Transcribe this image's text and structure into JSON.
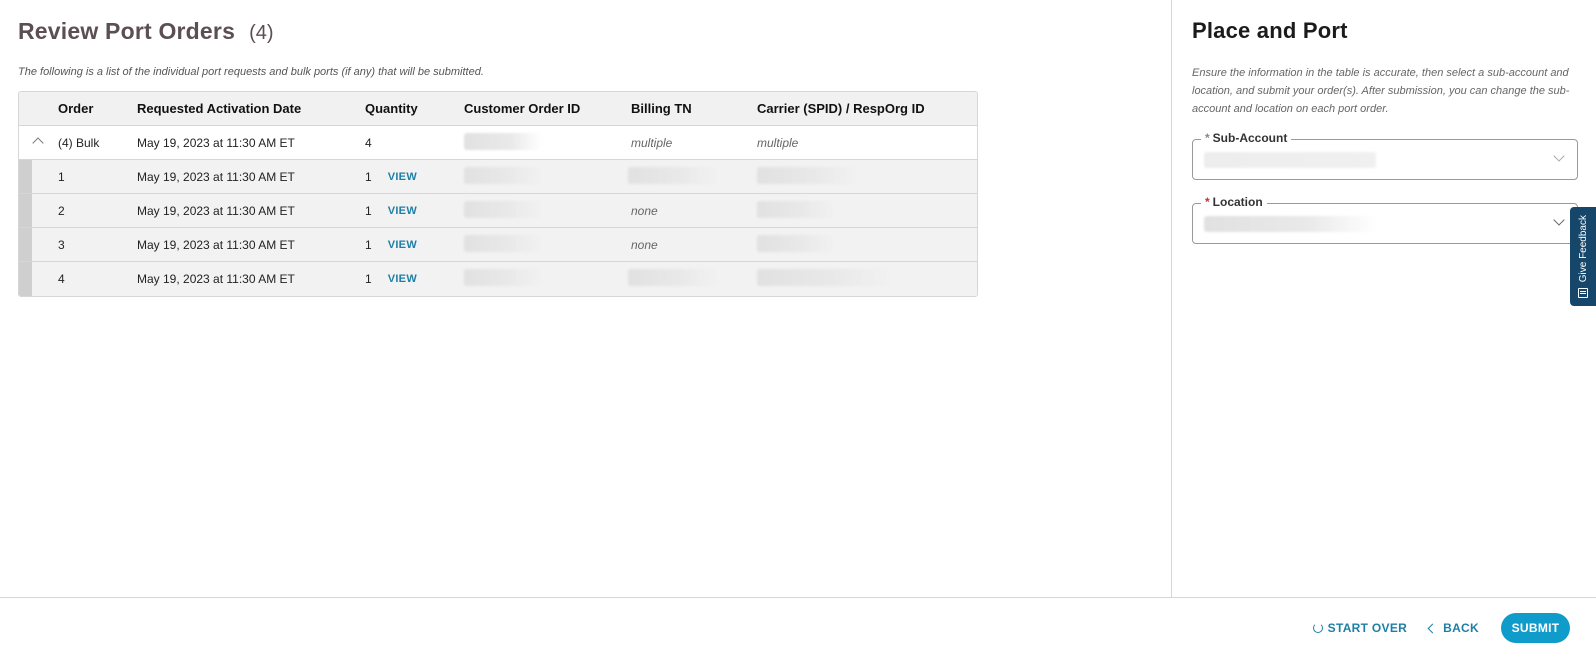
{
  "main": {
    "title": "Review Port Orders",
    "count": "(4)",
    "subtitle": "The following is a list of the individual port requests and bulk ports (if any) that will be submitted."
  },
  "table": {
    "headers": [
      "Order",
      "Requested Activation Date",
      "Quantity",
      "Customer Order ID",
      "Billing TN",
      "Carrier (SPID) / RespOrg ID"
    ],
    "bulk_row": {
      "order": "(4) Bulk",
      "date": "May 19, 2023 at 11:30 AM ET",
      "quantity": "4",
      "billing_tn": "multiple",
      "carrier": "multiple"
    },
    "rows": [
      {
        "order": "1",
        "date": "May 19, 2023 at 11:30 AM ET",
        "quantity": "1",
        "action": "VIEW",
        "billing_tn": ""
      },
      {
        "order": "2",
        "date": "May 19, 2023 at 11:30 AM ET",
        "quantity": "1",
        "action": "VIEW",
        "billing_tn": "none"
      },
      {
        "order": "3",
        "date": "May 19, 2023 at 11:30 AM ET",
        "quantity": "1",
        "action": "VIEW",
        "billing_tn": "none"
      },
      {
        "order": "4",
        "date": "May 19, 2023 at 11:30 AM ET",
        "quantity": "1",
        "action": "VIEW",
        "billing_tn": ""
      }
    ]
  },
  "side": {
    "title": "Place and Port",
    "description": "Ensure the information in the table is accurate, then select a sub-account and location, and submit your order(s). After submission, you can change the sub-account and location on each port order.",
    "sub_account_label": "Sub-Account",
    "location_label": "Location",
    "required_mark": "*"
  },
  "feedback": {
    "label": "Give Feedback"
  },
  "footer": {
    "start_over": "START OVER",
    "back": "BACK",
    "submit": "SUBMIT"
  },
  "colors": {
    "accent": "#0f9ccb",
    "link": "#1e7fa6",
    "feedback_bg": "#16476a",
    "title": "#5b4f52"
  }
}
